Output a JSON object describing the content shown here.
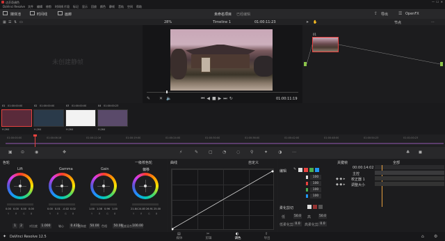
{
  "window": {
    "title": "达芬奇调色",
    "app_name": "DaVinci Resolve 12.5"
  },
  "menu": [
    "DaVinci Resolve",
    "文件",
    "编辑",
    "修剪",
    "时间线",
    "片段",
    "标记",
    "显示",
    "回放",
    "颜色",
    "静帧",
    "音轨",
    "空间",
    "帮助"
  ],
  "toolbar": {
    "media_pool": "媒体池",
    "timeline": "时间线",
    "gallery": "画廊",
    "project_title": "未命名项目",
    "edited": "已经编辑",
    "lightbox": "导出",
    "opens": "OpenFX",
    "zoom": "28%",
    "timeline_name": "Timeline 1",
    "timecode_top": "01:00:11:23",
    "nodes": "节点"
  },
  "gallery_empty": "未创建静帧",
  "viewer": {
    "timecode": "01:00:11:19"
  },
  "clips": [
    {
      "tc": "01:00:00:00",
      "codec": "H.264",
      "color": "#5a2a3a"
    },
    {
      "tc": "01:00:00:00",
      "codec": "H.264",
      "color": "#2a3a4a"
    },
    {
      "tc": "01:00:00:00",
      "codec": "H.264",
      "color": "#f2f2f2"
    },
    {
      "tc": "01:00:00:23",
      "codec": "H.264",
      "color": "#5a4a6a"
    }
  ],
  "ruler": [
    "01:00:00:00",
    "01:00:06:16",
    "01:00:12:16",
    "01:00:19:00",
    "01:00:24:00",
    "01:00:30:00",
    "01:00:36:00",
    "01:00:42:00",
    "01:00:48:00",
    "01:00:54:23",
    "01:01:00:23"
  ],
  "color_panel": {
    "title": "色轮",
    "mode": "一级校色轮",
    "wheels": [
      {
        "label": "Lift",
        "vals": [
          "0.00",
          "0.00",
          "0.00",
          "0.00"
        ]
      },
      {
        "label": "Gamma",
        "vals": [
          "0.00",
          "0.01",
          "-0.02",
          "0.02"
        ]
      },
      {
        "label": "Gain",
        "vals": [
          "1.00",
          "1.08",
          "0.96",
          "1.00"
        ]
      },
      {
        "label": "偏移",
        "vals": [
          "21.84",
          "24.83",
          "26.91",
          "25.00"
        ]
      }
    ],
    "channels": [
      "Y",
      "R",
      "G",
      "B"
    ],
    "params": [
      {
        "label": "对比度",
        "value": "1.000"
      },
      {
        "label": "轴心",
        "value": "0.435"
      },
      {
        "label": "饱和度",
        "value": "50.00"
      },
      {
        "label": "色相",
        "value": "50.00"
      },
      {
        "label": "亮度混合",
        "value": "100.00"
      }
    ],
    "page_nums": [
      "1",
      "2"
    ]
  },
  "curves": {
    "title": "曲线",
    "mode": "自定义"
  },
  "edit_panel": {
    "title": "编辑",
    "rows": [
      "100",
      "100",
      "100",
      "100"
    ],
    "soft_clip": "柔化剪切",
    "low": "低",
    "high": "高",
    "low_soft": "低柔化剪切",
    "high_soft": "高柔化剪切",
    "low_val": "50.0",
    "high_val": "50.0",
    "low_soft_val": "0.0",
    "high_soft_val": "0.0"
  },
  "keyframes": {
    "title": "关键帧",
    "scope": "全部",
    "tc": "00:00:14:02",
    "master": "主控",
    "items": [
      "校正器 1",
      "调整大小"
    ]
  },
  "pages": [
    "媒体",
    "剪辑",
    "调色",
    "导出"
  ],
  "colors": {
    "accent": "#e8423f",
    "node_green": "#8bc34a",
    "playhead": "#e8423f"
  }
}
